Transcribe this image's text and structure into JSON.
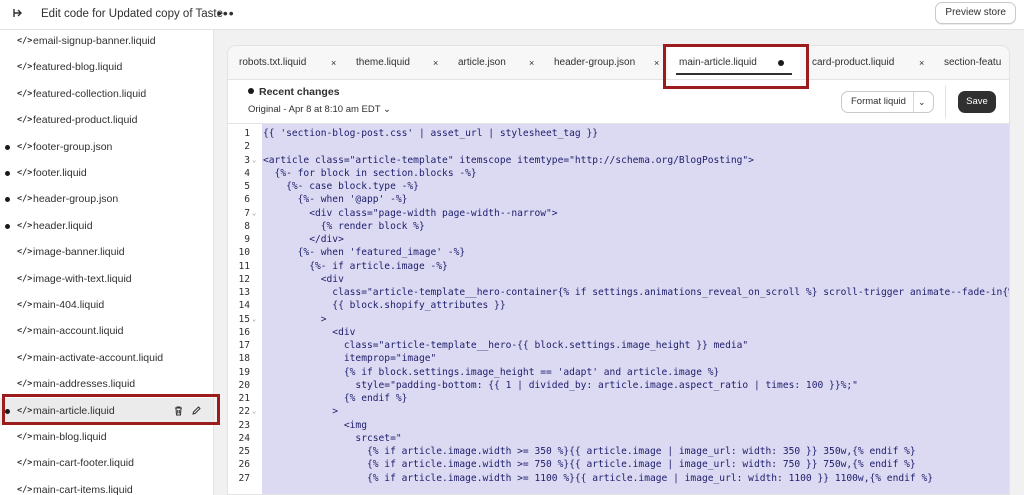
{
  "topbar": {
    "title": "Edit code for Updated copy of Taste",
    "more_label": "•••",
    "preview_label": "Preview store"
  },
  "sidebar": {
    "items": [
      {
        "label": "email-signup-banner.liquid",
        "modified": false,
        "active": false
      },
      {
        "label": "featured-blog.liquid",
        "modified": false,
        "active": false
      },
      {
        "label": "featured-collection.liquid",
        "modified": false,
        "active": false
      },
      {
        "label": "featured-product.liquid",
        "modified": false,
        "active": false
      },
      {
        "label": "footer-group.json",
        "modified": true,
        "active": false
      },
      {
        "label": "footer.liquid",
        "modified": true,
        "active": false
      },
      {
        "label": "header-group.json",
        "modified": true,
        "active": false
      },
      {
        "label": "header.liquid",
        "modified": true,
        "active": false
      },
      {
        "label": "image-banner.liquid",
        "modified": false,
        "active": false
      },
      {
        "label": "image-with-text.liquid",
        "modified": false,
        "active": false
      },
      {
        "label": "main-404.liquid",
        "modified": false,
        "active": false
      },
      {
        "label": "main-account.liquid",
        "modified": false,
        "active": false
      },
      {
        "label": "main-activate-account.liquid",
        "modified": false,
        "active": false
      },
      {
        "label": "main-addresses.liquid",
        "modified": false,
        "active": false
      },
      {
        "label": "main-article.liquid",
        "modified": true,
        "active": true
      },
      {
        "label": "main-blog.liquid",
        "modified": false,
        "active": false
      },
      {
        "label": "main-cart-footer.liquid",
        "modified": false,
        "active": false
      },
      {
        "label": "main-cart-items.liquid",
        "modified": false,
        "active": false
      }
    ],
    "file_icon": "</>"
  },
  "tabs": [
    {
      "label": "robots.txt.liquid",
      "active": false
    },
    {
      "label": "theme.liquid",
      "active": false
    },
    {
      "label": "article.json",
      "active": false
    },
    {
      "label": "header-group.json",
      "active": false
    },
    {
      "label": "main-article.liquid",
      "active": true
    },
    {
      "label": "card-product.liquid",
      "active": false
    },
    {
      "label": "section-featu",
      "active": false
    }
  ],
  "toolbar": {
    "recent_title": "Recent changes",
    "version_label": "Original - Apr 8 at 8:10 am EDT",
    "format_label": "Format liquid",
    "save_label": "Save"
  },
  "code_lines": [
    {
      "n": "1",
      "fold": false,
      "text": "{{ 'section-blog-post.css' | asset_url | stylesheet_tag }}"
    },
    {
      "n": "2",
      "fold": false,
      "text": ""
    },
    {
      "n": "3",
      "fold": true,
      "text": "<article class=\"article-template\" itemscope itemtype=\"http://schema.org/BlogPosting\">"
    },
    {
      "n": "4",
      "fold": false,
      "text": "  {%- for block in section.blocks -%}"
    },
    {
      "n": "5",
      "fold": false,
      "text": "    {%- case block.type -%}"
    },
    {
      "n": "6",
      "fold": false,
      "text": "      {%- when '@app' -%}"
    },
    {
      "n": "7",
      "fold": true,
      "text": "        <div class=\"page-width page-width--narrow\">"
    },
    {
      "n": "8",
      "fold": false,
      "text": "          {% render block %}"
    },
    {
      "n": "9",
      "fold": false,
      "text": "        </div>"
    },
    {
      "n": "10",
      "fold": false,
      "text": "      {%- when 'featured_image' -%}"
    },
    {
      "n": "11",
      "fold": false,
      "text": "        {%- if article.image -%}"
    },
    {
      "n": "12",
      "fold": false,
      "text": "          <div"
    },
    {
      "n": "13",
      "fold": false,
      "text": "            class=\"article-template__hero-container{% if settings.animations_reveal_on_scroll %} scroll-trigger animate--fade-in{%"
    },
    {
      "n": "14",
      "fold": false,
      "text": "            {{ block.shopify_attributes }}"
    },
    {
      "n": "15",
      "fold": true,
      "text": "          >"
    },
    {
      "n": "16",
      "fold": false,
      "text": "            <div"
    },
    {
      "n": "17",
      "fold": false,
      "text": "              class=\"article-template__hero-{{ block.settings.image_height }} media\""
    },
    {
      "n": "18",
      "fold": false,
      "text": "              itemprop=\"image\""
    },
    {
      "n": "19",
      "fold": false,
      "text": "              {% if block.settings.image_height == 'adapt' and article.image %}"
    },
    {
      "n": "20",
      "fold": false,
      "text": "                style=\"padding-bottom: {{ 1 | divided_by: article.image.aspect_ratio | times: 100 }}%;\""
    },
    {
      "n": "21",
      "fold": false,
      "text": "              {% endif %}"
    },
    {
      "n": "22",
      "fold": true,
      "text": "            >"
    },
    {
      "n": "23",
      "fold": false,
      "text": "              <img"
    },
    {
      "n": "24",
      "fold": false,
      "text": "                srcset=\""
    },
    {
      "n": "25",
      "fold": false,
      "text": "                  {% if article.image.width >= 350 %}{{ article.image | image_url: width: 350 }} 350w,{% endif %}"
    },
    {
      "n": "26",
      "fold": false,
      "text": "                  {% if article.image.width >= 750 %}{{ article.image | image_url: width: 750 }} 750w,{% endif %}"
    },
    {
      "n": "27",
      "fold": false,
      "text": "                  {% if article.image.width >= 1100 %}{{ article.image | image_url: width: 1100 }} 1100w,{% endif %}"
    }
  ],
  "colors": {
    "highlight": "#9b1c1c",
    "selection": "#dcdaf3",
    "save_bg": "#303030"
  }
}
